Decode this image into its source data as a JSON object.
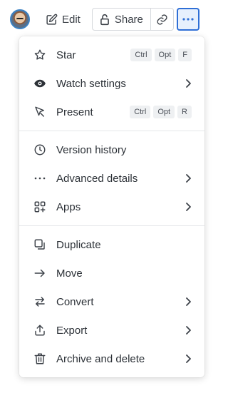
{
  "toolbar": {
    "edit_label": "Edit",
    "share_label": "Share"
  },
  "menu": {
    "section1": [
      {
        "label": "Star",
        "icon": "star-icon",
        "shortcut": [
          "Ctrl",
          "Opt",
          "F"
        ]
      },
      {
        "label": "Watch settings",
        "icon": "eye-icon",
        "submenu": true
      },
      {
        "label": "Present",
        "icon": "present-icon",
        "shortcut": [
          "Ctrl",
          "Opt",
          "R"
        ]
      }
    ],
    "section2": [
      {
        "label": "Version history",
        "icon": "clock-icon"
      },
      {
        "label": "Advanced details",
        "icon": "ellipsis-icon",
        "submenu": true
      },
      {
        "label": "Apps",
        "icon": "apps-icon",
        "submenu": true
      }
    ],
    "section3": [
      {
        "label": "Duplicate",
        "icon": "duplicate-icon"
      },
      {
        "label": "Move",
        "icon": "arrow-right-icon"
      },
      {
        "label": "Convert",
        "icon": "convert-icon",
        "submenu": true
      },
      {
        "label": "Export",
        "icon": "export-icon",
        "submenu": true
      },
      {
        "label": "Archive and delete",
        "icon": "trash-icon",
        "submenu": true
      }
    ]
  },
  "colors": {
    "accent": "#2f6fd6",
    "accent_bg": "#e7f0fd",
    "border": "#d5d8dc",
    "kbd_bg": "#eef0f2"
  }
}
